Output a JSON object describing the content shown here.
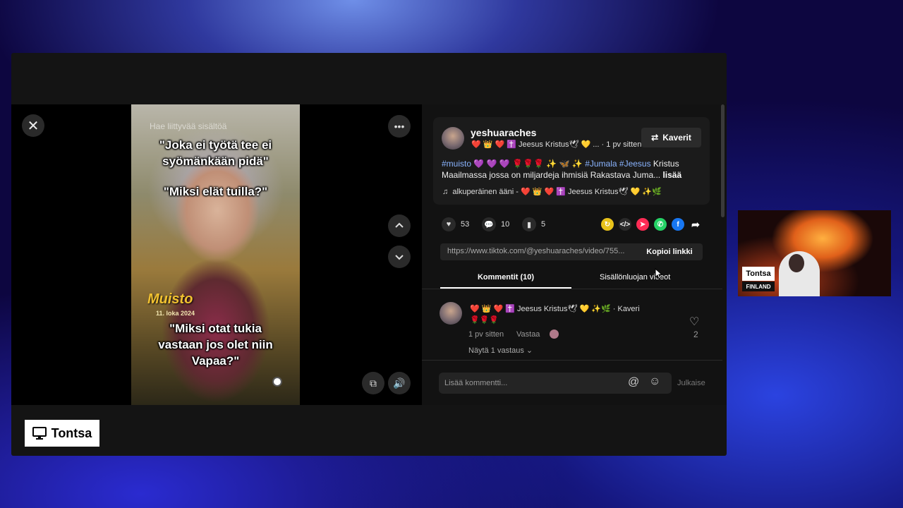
{
  "viewer": {
    "close_icon": "close-icon",
    "video": {
      "search_overlay": "Hae liittyvää sisältöä",
      "caption_1": "\"Joka ei työtä tee ei syömänkään pidä\"",
      "caption_2": "\"Miksi elät tuilla?\"",
      "muisto": "Muisto",
      "date": "11. loka 2024",
      "caption_3": "\"Miksi otat tukia vastaan jos olet niin Vapaa?\""
    }
  },
  "post": {
    "username": "yeshuaraches",
    "display_name": "❤️ 👑 ❤️ ✝️ Jeesus Kristus🕊 💛 ...",
    "time": "· 1 pv sitten",
    "follow_label": "Kaverit",
    "desc_tag1": "#muisto",
    "desc_mid": " 💜 💜 💜 🌹🌹🌹 ✨ 🦋 ✨ ",
    "desc_tag2": "#Jumala",
    "desc_tag3": "#Jeesus",
    "desc_text": " Kristus Maailmassa jossa on miljardeja ihmisiä Rakastava Juma... ",
    "more_label": "lisää",
    "sound": "alkuperäinen ääni - ❤️ 👑 ❤️ ✝️ Jeesus Kristus🕊 💛 ✨🌿"
  },
  "stats": {
    "likes": "53",
    "comments": "10",
    "saves": "5"
  },
  "link": {
    "url": "https://www.tiktok.com/@yeshuaraches/video/755...",
    "copy_label": "Kopioi linkki"
  },
  "tabs": {
    "comments": "Kommentit (10)",
    "creator_videos": "Sisällönluojan videot"
  },
  "comment": {
    "author": "❤️ 👑 ❤️ ✝️ Jeesus Kristus🕊 💛 ✨🌿 · Kaveri",
    "text": "🌹🌹🌹",
    "time": "1 pv sitten",
    "reply_label": "Vastaa",
    "likes": "2",
    "view_replies": "Näytä 1 vastaus ⌄"
  },
  "compose": {
    "placeholder": "Lisää kommentti...",
    "publish_label": "Julkaise"
  },
  "brand": {
    "name": "Tontsa",
    "icon": "monitor-icon"
  },
  "camera": {
    "name": "Tontsa",
    "country": "FINLAND"
  },
  "colors": {
    "hashtag": "#8ab4ff",
    "accent_bg": "#121212"
  }
}
